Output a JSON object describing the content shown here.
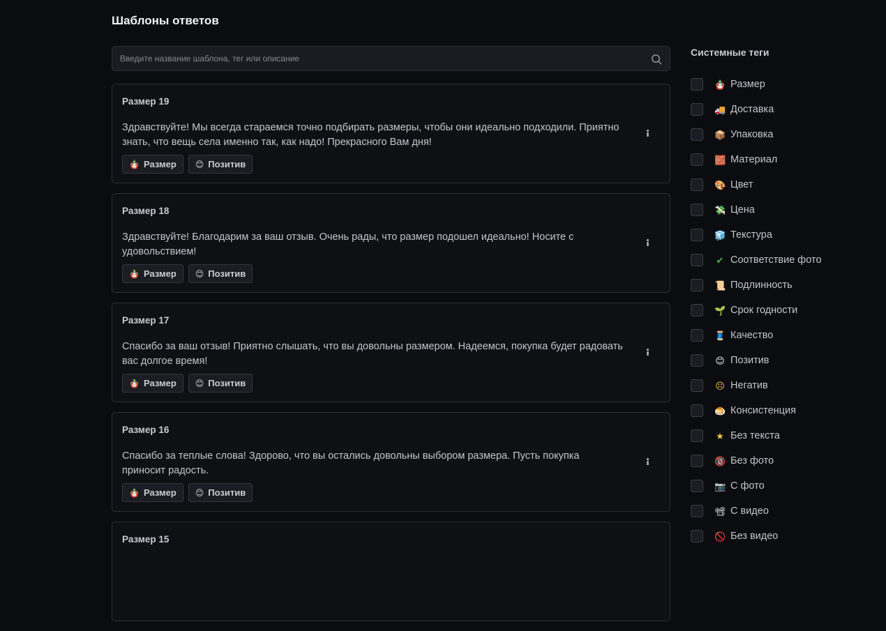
{
  "page": {
    "title": "Шаблоны ответов"
  },
  "search": {
    "placeholder": "Введите название шаблона, тег или описание",
    "value": ""
  },
  "templates": [
    {
      "title": "Размер 19",
      "text": "Здравствуйте! Мы всегда стараемся точно подбирать размеры, чтобы они идеально подходили. Приятно знать, что вещь села именно так, как надо! Прекрасного Вам дня!",
      "tags": [
        {
          "icon": "🪆",
          "label": "Размер"
        },
        {
          "icon": "😊",
          "label": "Позитив"
        }
      ]
    },
    {
      "title": "Размер 18",
      "text": "Здравствуйте! Благодарим за ваш отзыв. Очень рады, что размер подошел идеально! Носите с удовольствием!",
      "tags": [
        {
          "icon": "🪆",
          "label": "Размер"
        },
        {
          "icon": "😊",
          "label": "Позитив"
        }
      ]
    },
    {
      "title": "Размер 17",
      "text": "Спасибо за ваш отзыв! Приятно слышать, что вы довольны размером. Надеемся, покупка будет радовать вас долгое время!",
      "tags": [
        {
          "icon": "🪆",
          "label": "Размер"
        },
        {
          "icon": "😊",
          "label": "Позитив"
        }
      ]
    },
    {
      "title": "Размер 16",
      "text": "Спасибо за теплые слова! Здорово, что вы остались довольны выбором размера. Пусть покупка приносит радость.",
      "tags": [
        {
          "icon": "🪆",
          "label": "Размер"
        },
        {
          "icon": "😊",
          "label": "Позитив"
        }
      ]
    },
    {
      "title": "Размер 15",
      "text": "",
      "tags": []
    }
  ],
  "sidebar": {
    "title": "Системные теги",
    "tags": [
      {
        "icon": "🪆",
        "label": "Размер"
      },
      {
        "icon": "🚚",
        "label": "Доставка"
      },
      {
        "icon": "📦",
        "label": "Упаковка"
      },
      {
        "icon": "🧱",
        "label": "Материал"
      },
      {
        "icon": "🎨",
        "label": "Цвет"
      },
      {
        "icon": "💸",
        "label": "Цена"
      },
      {
        "icon": "🧊",
        "label": "Текстура"
      },
      {
        "icon": "✔",
        "label": "Соответствие фото"
      },
      {
        "icon": "📜",
        "label": "Подлинность"
      },
      {
        "icon": "🌱",
        "label": "Срок годности"
      },
      {
        "icon": "🧵",
        "label": "Качество"
      },
      {
        "icon": "😊",
        "label": "Позитив"
      },
      {
        "icon": "☹",
        "label": "Негатив"
      },
      {
        "icon": "🍮",
        "label": "Консистенция"
      },
      {
        "icon": "★",
        "label": "Без текста"
      },
      {
        "icon": "🔞",
        "label": "Без фото"
      },
      {
        "icon": "📷",
        "label": "С фото"
      },
      {
        "icon": "📽",
        "label": "С видео"
      },
      {
        "icon": "🚫",
        "label": "Без видео"
      }
    ]
  },
  "colors": {
    "background": "#0b0c10",
    "card_border": "#2c2f37",
    "check_mark": "#3fbf3f",
    "star": "#f2c744"
  }
}
